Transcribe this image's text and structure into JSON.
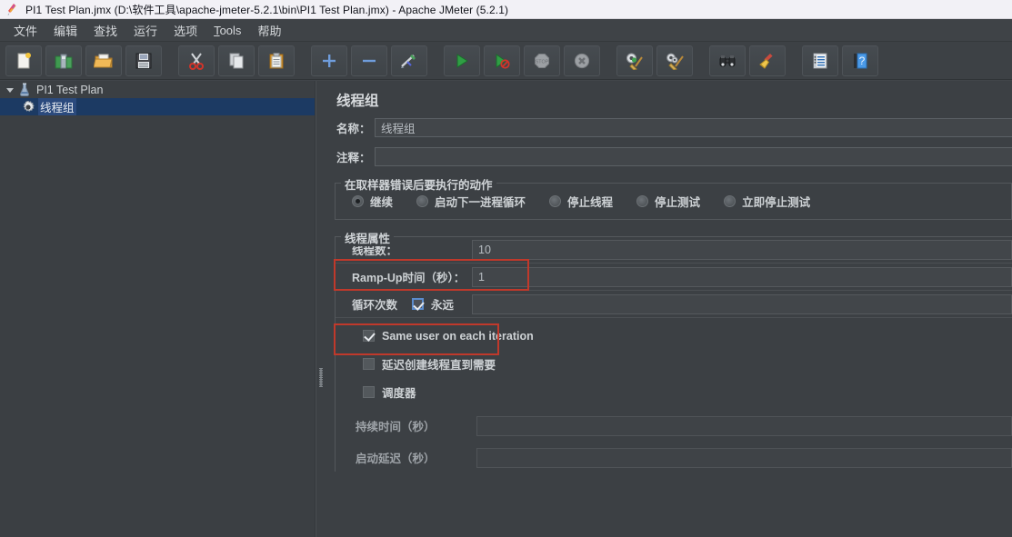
{
  "window": {
    "title": "PI1 Test Plan.jmx (D:\\软件工具\\apache-jmeter-5.2.1\\bin\\PI1 Test Plan.jmx) - Apache JMeter (5.2.1)",
    "app_icon": "jmeter-feather-icon"
  },
  "menubar": {
    "items": [
      {
        "label": "文件",
        "name": "menu-file"
      },
      {
        "label": "编辑",
        "name": "menu-edit"
      },
      {
        "label": "查找",
        "name": "menu-search"
      },
      {
        "label": "运行",
        "name": "menu-run"
      },
      {
        "label": "选项",
        "name": "menu-options"
      },
      {
        "label": "Tools",
        "name": "menu-tools",
        "mnemonic": "T"
      },
      {
        "label": "帮助",
        "name": "menu-help"
      }
    ]
  },
  "toolbar": {
    "buttons": [
      {
        "name": "new-button",
        "icon": "new-document-icon",
        "tooltip": "新建"
      },
      {
        "name": "templates-button",
        "icon": "templates-icon",
        "tooltip": "模板"
      },
      {
        "name": "open-button",
        "icon": "open-folder-icon",
        "tooltip": "打开"
      },
      {
        "name": "save-button",
        "icon": "floppy-disk-icon",
        "tooltip": "保存"
      },
      {
        "name": "cut-button",
        "icon": "scissors-icon",
        "tooltip": "剪切"
      },
      {
        "name": "copy-button",
        "icon": "copy-pages-icon",
        "tooltip": "复制"
      },
      {
        "name": "paste-button",
        "icon": "clipboard-icon",
        "tooltip": "粘贴"
      },
      {
        "name": "expand-all-button",
        "icon": "plus-icon",
        "tooltip": "展开"
      },
      {
        "name": "collapse-all-button",
        "icon": "minus-icon",
        "tooltip": "折叠"
      },
      {
        "name": "toggle-button",
        "icon": "toggle-pencil-icon",
        "tooltip": "切换"
      },
      {
        "name": "start-button",
        "icon": "green-play-icon",
        "tooltip": "启动"
      },
      {
        "name": "start-no-pauses-button",
        "icon": "play-no-pause-icon",
        "tooltip": "无间隔启动"
      },
      {
        "name": "stop-button",
        "icon": "stop-sign-icon",
        "tooltip": "停止"
      },
      {
        "name": "shutdown-button",
        "icon": "shutdown-x-icon",
        "tooltip": "关闭"
      },
      {
        "name": "clear-button",
        "icon": "gear-broom-icon",
        "tooltip": "清除"
      },
      {
        "name": "clear-all-button",
        "icon": "gears-broom-icon",
        "tooltip": "清除全部"
      },
      {
        "name": "search-button",
        "icon": "binoculars-icon",
        "tooltip": "搜索"
      },
      {
        "name": "reset-search-button",
        "icon": "yellow-broom-icon",
        "tooltip": "重置搜索"
      },
      {
        "name": "function-helper-button",
        "icon": "list-notes-icon",
        "tooltip": "函数助手"
      },
      {
        "name": "help-button",
        "icon": "blue-book-question-icon",
        "tooltip": "帮助"
      }
    ]
  },
  "tree": {
    "nodes": [
      {
        "label": "PI1 Test Plan",
        "icon": "test-plan-icon",
        "expanded": true,
        "selected": false
      },
      {
        "label": "线程组",
        "icon": "thread-group-gear-icon",
        "expanded": false,
        "selected": true
      }
    ]
  },
  "panel": {
    "title": "线程组",
    "name_label": "名称：",
    "name_value": "线程组",
    "comment_label": "注释：",
    "comment_value": "",
    "error_action": {
      "legend": "在取样器错误后要执行的动作",
      "options": [
        {
          "label": "继续",
          "checked": true
        },
        {
          "label": "启动下一进程循环",
          "checked": false
        },
        {
          "label": "停止线程",
          "checked": false
        },
        {
          "label": "停止测试",
          "checked": false
        },
        {
          "label": "立即停止测试",
          "checked": false
        }
      ]
    },
    "thread_props": {
      "legend": "线程属性",
      "threads_label": "线程数：",
      "threads_value": "10",
      "rampup_label": "Ramp-Up时间（秒）：",
      "rampup_value": "1",
      "loops_label": "循环次数",
      "forever_label": "永远",
      "forever_checked": true,
      "loops_value": "",
      "same_user_label": "Same user on each iteration",
      "same_user_checked": true,
      "delayed_start_label": "延迟创建线程直到需要",
      "delayed_start_checked": false,
      "scheduler_label": "调度器",
      "scheduler_checked": false,
      "duration_label": "持续时间（秒）",
      "duration_value": "",
      "startup_delay_label": "启动延迟（秒）",
      "startup_delay_value": ""
    }
  },
  "annotations": {
    "color": "#c0392b",
    "boxes": [
      {
        "name": "highlight-threads-row"
      },
      {
        "name": "highlight-loop-forever"
      }
    ]
  }
}
